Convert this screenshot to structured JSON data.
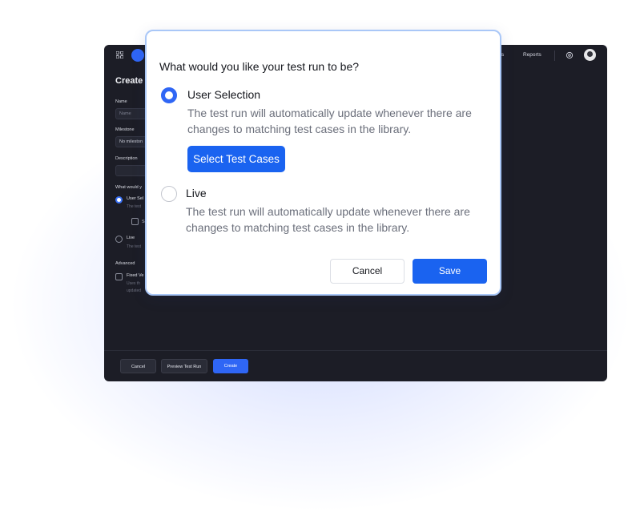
{
  "app": {
    "page_title": "Create",
    "nav": {
      "cases": "ses",
      "reports": "Reports"
    },
    "form": {
      "name_label": "Name",
      "name_placeholder": "Name",
      "milestone_label": "Milestone",
      "milestone_value": "No mileston",
      "description_label": "Description",
      "question_label": "What would y",
      "option_user": "User Sel",
      "option_user_sub": "The test",
      "selected_label": "S",
      "option_live": "Live",
      "option_live_sub": "The test",
      "advanced_label": "Advanced",
      "fixed_label": "Fixed Ve",
      "fixed_sub_1": "Uses th",
      "fixed_sub_2": "updated"
    },
    "footer": {
      "cancel": "Cancel",
      "preview": "Preview Test Run",
      "create": "Create"
    }
  },
  "modal": {
    "title": "What would you like your test run to be?",
    "options": [
      {
        "label": "User Selection",
        "desc_1": "The test run will automatically update whenever there are",
        "desc_2": "changes to matching test cases in the library.",
        "selected": true
      },
      {
        "label": "Live",
        "desc_1": "The test run will automatically update whenever there are",
        "desc_2": "changes to matching test cases in the library.",
        "selected": false
      }
    ],
    "select_button": "Select Test Cases",
    "cancel_button": "Cancel",
    "save_button": "Save"
  },
  "colors": {
    "accent": "#1a63f0",
    "app_bg": "#1c1d26",
    "modal_border": "#a9c7f7"
  }
}
